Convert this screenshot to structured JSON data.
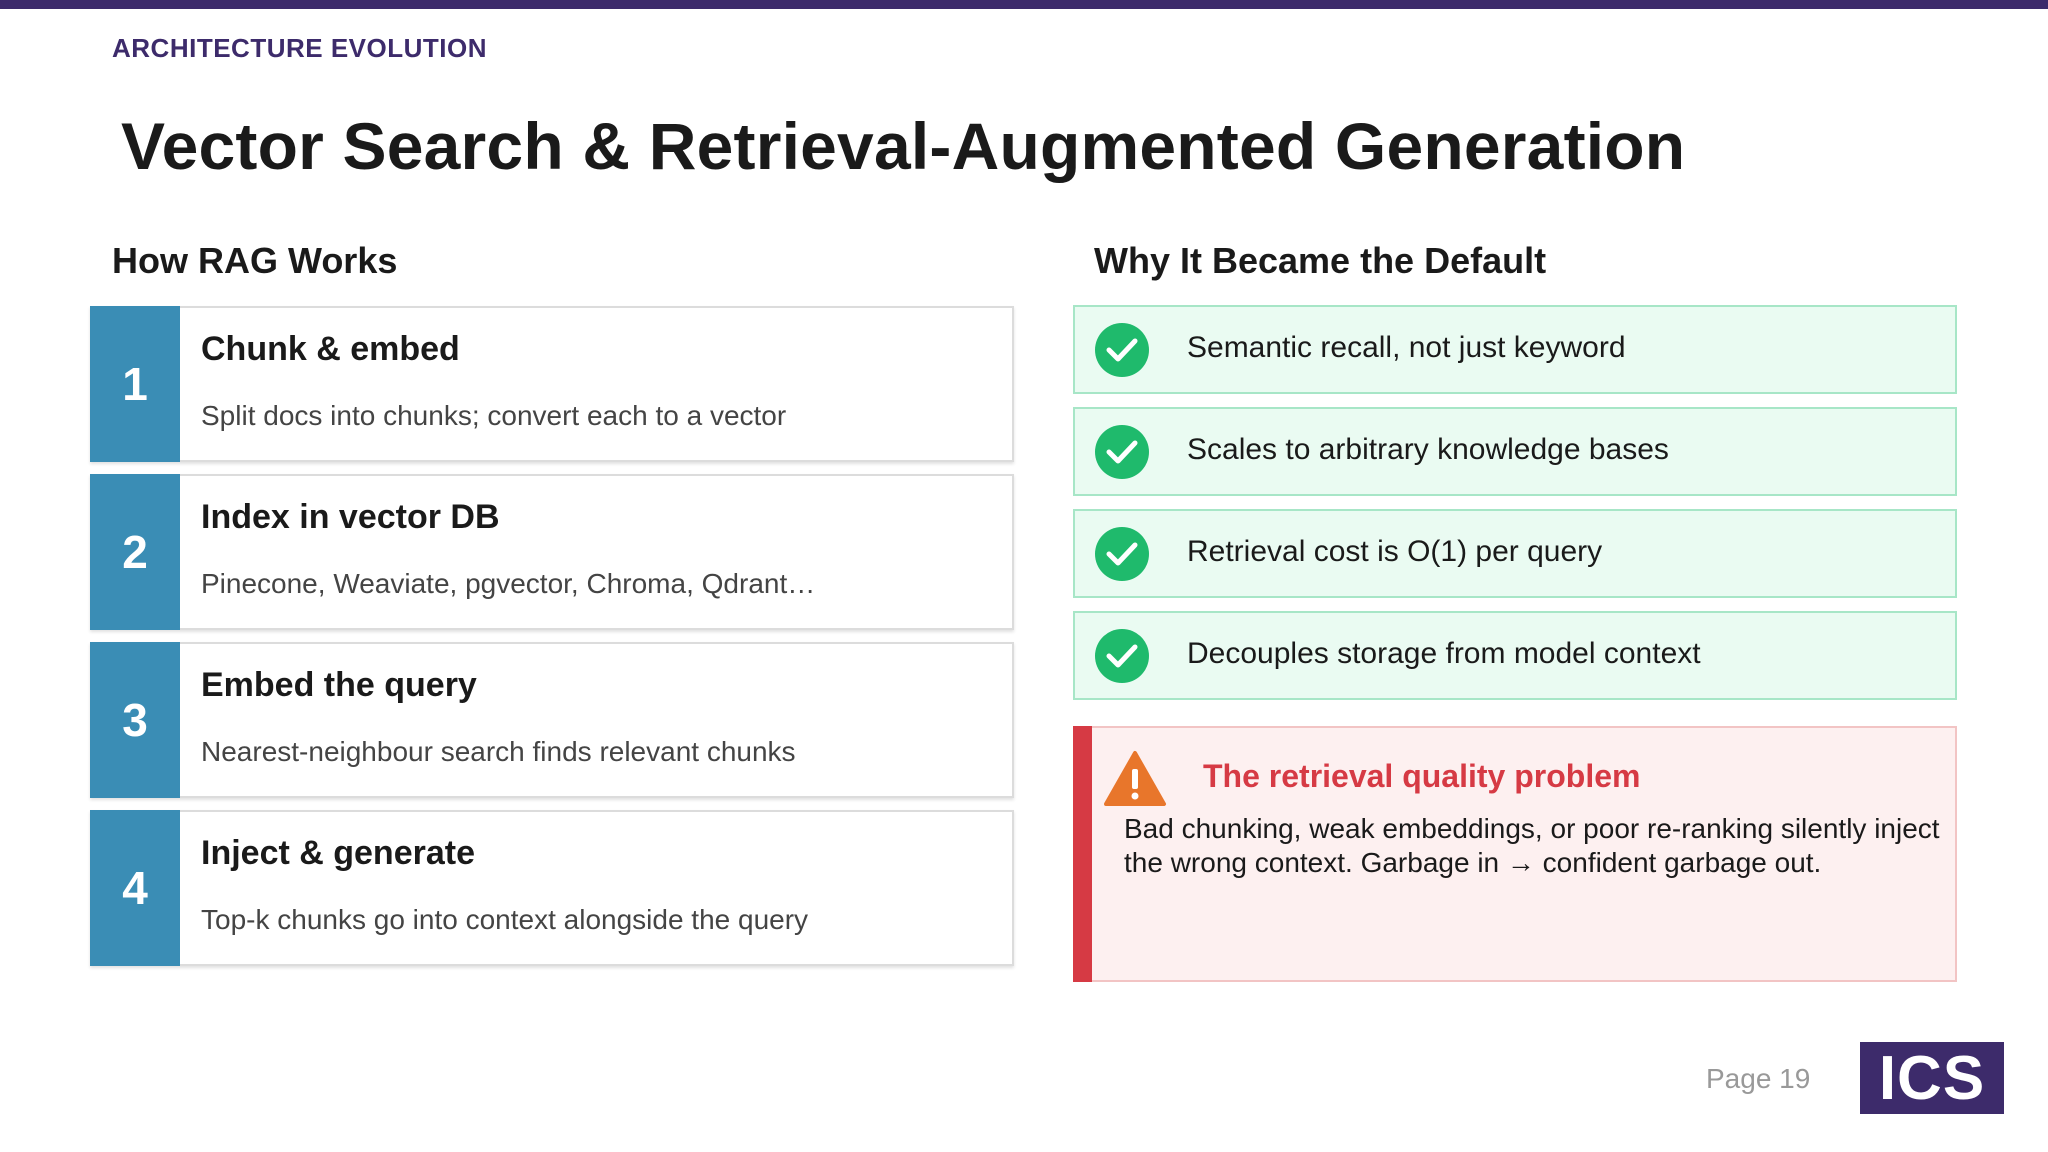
{
  "section_label": "ARCHITECTURE EVOLUTION",
  "title": "Vector Search & Retrieval-Augmented Generation",
  "left_heading": "How RAG Works",
  "right_heading": "Why It Became the Default",
  "steps": [
    {
      "num": "1",
      "title": "Chunk & embed",
      "desc": "Split docs into chunks; convert each to a vector"
    },
    {
      "num": "2",
      "title": "Index in vector DB",
      "desc": "Pinecone, Weaviate, pgvector, Chroma, Qdrant…"
    },
    {
      "num": "3",
      "title": "Embed the query",
      "desc": "Nearest-neighbour search finds relevant chunks"
    },
    {
      "num": "4",
      "title": "Inject & generate",
      "desc": "Top-k chunks go into context alongside the query"
    }
  ],
  "benefits": [
    {
      "icon": "check-circle-icon",
      "text": "Semantic recall, not just keyword"
    },
    {
      "icon": "check-circle-icon",
      "text": "Scales to arbitrary knowledge bases"
    },
    {
      "icon": "check-circle-icon",
      "text": "Retrieval cost is O(1) per query"
    },
    {
      "icon": "check-circle-icon",
      "text": "Decouples storage from model context"
    }
  ],
  "warning": {
    "icon": "warning-triangle-icon",
    "title": "The retrieval quality problem",
    "body": "Bad chunking, weak embeddings, or poor re-ranking silently inject the wrong context. Garbage in → confident garbage out."
  },
  "footer": {
    "page": "Page 19",
    "logo": "ICS"
  },
  "colors": {
    "brand": "#3d2b6b",
    "step_accent": "#3a8db5",
    "success": "#1fba6c",
    "danger": "#d63a44",
    "warning_icon": "#e8762b"
  }
}
